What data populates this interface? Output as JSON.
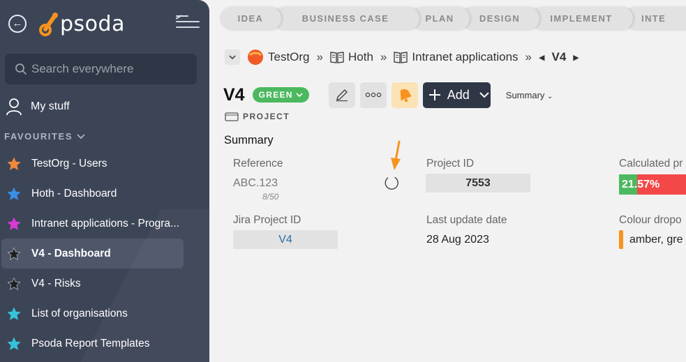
{
  "sidebar": {
    "logo_text": "psoda",
    "search_placeholder": "Search everywhere",
    "my_stuff_label": "My stuff",
    "favourites_heading": "FAVOURITES",
    "favourites": [
      {
        "label": "TestOrg - Users",
        "star_color": "#f0883a"
      },
      {
        "label": "Hoth - Dashboard",
        "star_color": "#3a8ee6"
      },
      {
        "label": "Intranet applications - Progra...",
        "star_color": "#d83ad6"
      },
      {
        "label": "V4 - Dashboard",
        "star_color": "#1f1f1f",
        "active": true
      },
      {
        "label": "V4 - Risks",
        "star_color": "#1f1f1f"
      },
      {
        "label": "List of organisations",
        "star_color": "#36c2d8"
      },
      {
        "label": "Psoda Report Templates",
        "star_color": "#36c2d8"
      }
    ]
  },
  "stages": [
    "IDEA",
    "BUSINESS CASE",
    "PLAN",
    "DESIGN",
    "IMPLEMENT",
    "INTE"
  ],
  "breadcrumbs": {
    "org": "TestOrg",
    "items": [
      "Hoth",
      "Intranet applications"
    ],
    "current": "V4",
    "separator": "»"
  },
  "header": {
    "title": "V4",
    "status": "GREEN",
    "type_label": "PROJECT",
    "add_label": "Add",
    "view_dropdown": "Summary"
  },
  "summary": {
    "section_title": "Summary",
    "reference": {
      "label": "Reference",
      "value": "ABC.123",
      "char_count": "8/50"
    },
    "project_id": {
      "label": "Project ID",
      "value": "7553"
    },
    "calculated": {
      "label": "Calculated pr",
      "value": "21.57%",
      "progress_percent": 21.57
    },
    "jira": {
      "label": "Jira Project ID",
      "value": "V4"
    },
    "last_update": {
      "label": "Last update date",
      "value": "28 Aug 2023"
    },
    "colour_dropdown": {
      "label": "Colour dropo",
      "value": "amber, gre"
    }
  },
  "colors": {
    "sidebar_bg": "#3c4556",
    "accent_orange": "#f7931e",
    "green": "#4cb960",
    "red": "#f44848",
    "link_blue": "#2f6ea8"
  }
}
